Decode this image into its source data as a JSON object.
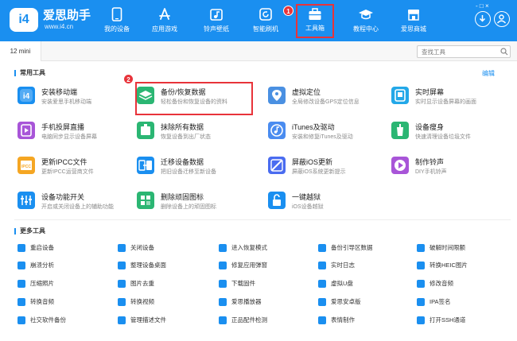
{
  "app": {
    "logo_mark": "i4",
    "name": "爱思助手",
    "url": "www.i4.cn",
    "window_controls": "- □ ×"
  },
  "nav": [
    {
      "label": "我的设备",
      "icon": "phone-icon"
    },
    {
      "label": "应用游戏",
      "icon": "app-store-icon"
    },
    {
      "label": "铃声壁纸",
      "icon": "music-icon"
    },
    {
      "label": "智能刷机",
      "icon": "refresh-icon"
    },
    {
      "label": "工具箱",
      "icon": "toolbox-icon",
      "active": true,
      "badge": "1"
    },
    {
      "label": "教程中心",
      "icon": "graduation-cap-icon"
    },
    {
      "label": "爱思商城",
      "icon": "store-icon"
    }
  ],
  "tab": {
    "device": "12 mini"
  },
  "search": {
    "placeholder": "查找工具"
  },
  "common": {
    "title": "常用工具",
    "edit": "编辑",
    "callout_badge": "2",
    "tools": [
      {
        "title": "安装移动端",
        "desc": "安装爱思手机移动端",
        "color": "#1a8ff0"
      },
      {
        "title": "备份/恢复数据",
        "desc": "轻松备份和恢复设备的资料",
        "color": "#2bb673",
        "highlight": true
      },
      {
        "title": "虚拟定位",
        "desc": "全局修改设备GPS定位信息",
        "color": "#4a90e2"
      },
      {
        "title": "实时屏幕",
        "desc": "实时显示设备屏幕的画面",
        "color": "#23a8e8"
      },
      {
        "title": "手机投屏直播",
        "desc": "电脑同步显示设备屏幕",
        "color": "#a855d8"
      },
      {
        "title": "抹除所有数据",
        "desc": "恢复设备到出厂状态",
        "color": "#2bb673"
      },
      {
        "title": "iTunes及驱动",
        "desc": "安装和修复iTunes及驱动",
        "color": "#4a8cf0"
      },
      {
        "title": "设备瘦身",
        "desc": "快速清理设备垃圾文件",
        "color": "#2bb673"
      },
      {
        "title": "更新IPCC文件",
        "desc": "更新IPCC运营商文件",
        "color": "#f5a623"
      },
      {
        "title": "迁移设备数据",
        "desc": "把旧设备迁移至新设备",
        "color": "#1a8ff0"
      },
      {
        "title": "屏蔽iOS更新",
        "desc": "屏蔽iOS系统更新提示",
        "color": "#4a6cf0"
      },
      {
        "title": "制作铃声",
        "desc": "DIY手机铃声",
        "color": "#a855d8"
      },
      {
        "title": "设备功能开关",
        "desc": "开启或关闭设备上的辅助功能",
        "color": "#1a8ff0"
      },
      {
        "title": "删除顽固图标",
        "desc": "删除设备上的顽固图标",
        "color": "#2bb673"
      },
      {
        "title": "一键越狱",
        "desc": "iOS设备越狱",
        "color": "#1a8ff0"
      }
    ]
  },
  "more": {
    "title": "更多工具",
    "items": [
      {
        "label": "重启设备",
        "color": "#1a8ff0"
      },
      {
        "label": "关闭设备",
        "color": "#1a8ff0"
      },
      {
        "label": "进入恢复模式",
        "color": "#1a8ff0"
      },
      {
        "label": "备份引导区数据",
        "color": "#1a8ff0"
      },
      {
        "label": "破解时间限额",
        "color": "#1a8ff0"
      },
      {
        "label": "崩溃分析",
        "color": "#1a8ff0"
      },
      {
        "label": "整理设备桌面",
        "color": "#1a8ff0"
      },
      {
        "label": "修复应用弹窗",
        "color": "#1a8ff0"
      },
      {
        "label": "实时日志",
        "color": "#1a8ff0"
      },
      {
        "label": "转换HEIC图片",
        "color": "#1a8ff0"
      },
      {
        "label": "压缩照片",
        "color": "#1a8ff0"
      },
      {
        "label": "图片去重",
        "color": "#1a8ff0"
      },
      {
        "label": "下载固件",
        "color": "#1a8ff0"
      },
      {
        "label": "虚拟U盘",
        "color": "#1a8ff0"
      },
      {
        "label": "修改音频",
        "color": "#1a8ff0"
      },
      {
        "label": "转换音频",
        "color": "#1a8ff0"
      },
      {
        "label": "转换视频",
        "color": "#1a8ff0"
      },
      {
        "label": "爱思播放器",
        "color": "#1a8ff0"
      },
      {
        "label": "爱思安卓版",
        "color": "#1a8ff0"
      },
      {
        "label": "IPA签名",
        "color": "#1a8ff0"
      },
      {
        "label": "社交软件备份",
        "color": "#1a8ff0"
      },
      {
        "label": "管理描述文件",
        "color": "#1a8ff0"
      },
      {
        "label": "正品配件检测",
        "color": "#1a8ff0"
      },
      {
        "label": "表情制作",
        "color": "#1a8ff0"
      },
      {
        "label": "打开SSH通道",
        "color": "#1a8ff0"
      }
    ]
  }
}
